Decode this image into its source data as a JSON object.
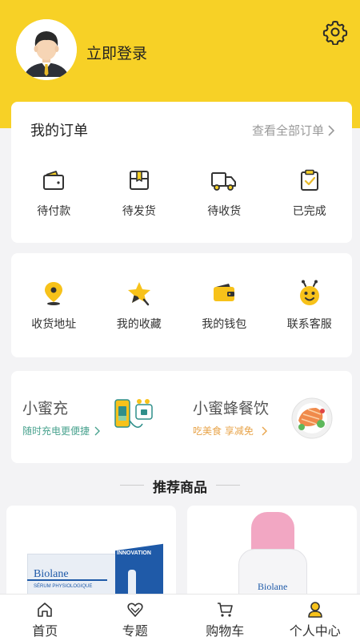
{
  "header": {
    "login_label": "立即登录",
    "settings_icon": "gear-icon",
    "avatar_icon": "avatar-icon",
    "bg_color": "#f7d126"
  },
  "orders": {
    "title": "我的订单",
    "view_all": "查看全部订单",
    "items": [
      {
        "label": "待付款",
        "icon": "wallet-icon"
      },
      {
        "label": "待发货",
        "icon": "package-icon"
      },
      {
        "label": "待收货",
        "icon": "truck-icon"
      },
      {
        "label": "已完成",
        "icon": "clipboard-check-icon"
      }
    ]
  },
  "services": {
    "items": [
      {
        "label": "收货地址",
        "icon": "location-pin-icon"
      },
      {
        "label": "我的收藏",
        "icon": "star-icon"
      },
      {
        "label": "我的钱包",
        "icon": "wallet-icon"
      },
      {
        "label": "联系客服",
        "icon": "bee-icon"
      }
    ]
  },
  "promos": [
    {
      "title": "小蜜充",
      "subtitle": "随时充电更便捷",
      "subtitle_color": "#4aa38f",
      "icon": "power-bank-icon"
    },
    {
      "title": "小蜜蜂餐饮",
      "subtitle": "吃美食 享减免",
      "subtitle_color": "#e8a44a",
      "icon": "food-plate-icon"
    }
  ],
  "recommend": {
    "title": "推荐商品",
    "products": [
      {
        "image_text": "Biolane",
        "image_text2": "SÉRUM PHYSIOLOGIQUE",
        "badge": "INNOVATION"
      },
      {
        "image_text": "Biolane"
      }
    ]
  },
  "tabbar": {
    "items": [
      {
        "label": "首页",
        "icon": "home-icon"
      },
      {
        "label": "专题",
        "icon": "heart-icon"
      },
      {
        "label": "购物车",
        "icon": "cart-icon"
      },
      {
        "label": "个人中心",
        "icon": "user-icon",
        "active": true
      }
    ]
  }
}
